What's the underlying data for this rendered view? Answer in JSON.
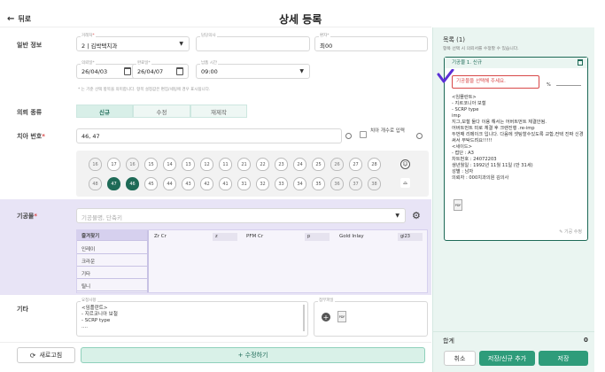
{
  "header": {
    "back_label": "뒤로",
    "title": "상세 등록"
  },
  "general": {
    "label": "일반 정보",
    "clinic": {
      "label": "거래처",
      "required": "*",
      "value": "2 | 김박택치과"
    },
    "manager": {
      "label": "담당의사"
    },
    "patient": {
      "label": "환자*",
      "value": "최00"
    },
    "date_in": {
      "label": "의뢰일*",
      "value": "26/04/03"
    },
    "date_out": {
      "label": "완료일*",
      "value": "26/04/07"
    },
    "time": {
      "label": "납품 시간",
      "value": "09:00"
    },
    "note": "* 는 기준 선택 항목을 의미합니다. 항목 설정값은 편집/세팅에 경우 표시됩니다."
  },
  "request": {
    "label": "의뢰 종류",
    "options": [
      "신규",
      "수정",
      "재제작"
    ]
  },
  "tooth": {
    "label": "치아 번호",
    "required": "*",
    "value": "46, 47",
    "count_label": "치아 개수로 입력",
    "upper": [
      "16",
      "17",
      "16",
      "15",
      "14",
      "13",
      "12",
      "11",
      "21",
      "22",
      "23",
      "24",
      "25",
      "26",
      "27",
      "28"
    ],
    "lower": [
      "48",
      "47",
      "46",
      "45",
      "44",
      "43",
      "42",
      "41",
      "31",
      "32",
      "33",
      "34",
      "35",
      "36",
      "37",
      "38"
    ]
  },
  "prosth": {
    "label": "기공물",
    "required": "*",
    "placeholder": "기공물명, 단축키",
    "tabs": [
      "즐겨찾기",
      "인레이",
      "크라운",
      "기타",
      "틸니"
    ],
    "items": [
      {
        "name": "Zr Cr",
        "code": "z"
      },
      {
        "name": "PFM Cr",
        "code": "p"
      },
      {
        "name": "Gold Inlay",
        "code": "gi23"
      }
    ]
  },
  "etc": {
    "label": "기타",
    "memo_label": "요청사항",
    "attach_label": "첨부파일",
    "memo_lines": [
      "<임플란트>",
      "- 지르코니아 보철",
      "- SCRP type",
      "...."
    ]
  },
  "bottom": {
    "reset": "새로고침",
    "add": "+ 수정하기"
  },
  "panel": {
    "title": "목록 (1)",
    "subtitle": "항목 선택 시 의뢰서를 수정할 수 있습니다.",
    "card": {
      "tag": "기공물 1. 신규",
      "error": "기공물을 선택해 주세요.",
      "unit": "%",
      "body": [
        "<임플란트>",
        "- 지르코니아 보철",
        "- SCRP type",
        "imp",
        "지그,보철 둘다 이용 해서는 어버트먼트 체결안됨.",
        "어버트먼트 따로 체결 후 크랜진행 .re-imp",
        "두번째 리메이크 입니다. 다음에 셋팅할수있도록 교합,컨택 진짜 신경써서 부탁드려요!!!!!",
        "<세이드>",
        "- 접단 : A3",
        "차트번호 : 24072203",
        "생년월일 : 1992년 11월 11일 (만 31세)",
        "성별 : 남자",
        "의뢰자 : 000치과의원   김의사"
      ],
      "edit": "기공 수정"
    },
    "total_label": "합계",
    "total_value": "0",
    "cancel": "취소",
    "save_new": "저장/신규 추가",
    "save": "저장"
  },
  "colors": {
    "teal": "#1e6a57",
    "accent": "#2e9c7a",
    "lavender": "#e8e4f6",
    "panel_bg": "#eaf5f1",
    "error": "#d84848"
  }
}
